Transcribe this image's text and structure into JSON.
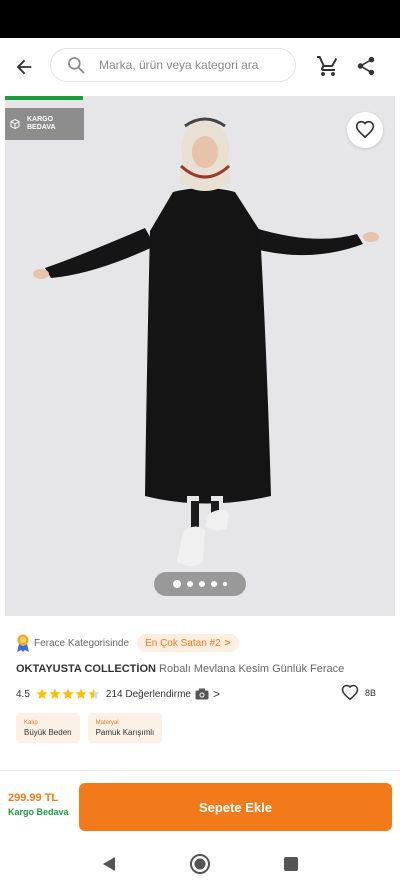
{
  "header": {
    "search_placeholder": "Marka, ürün veya kategori ara"
  },
  "icons": {
    "back": "arrow-left-icon",
    "search": "search-icon",
    "cart": "cart-icon",
    "share": "share-icon",
    "favorite": "heart-icon",
    "kargo": "box-icon",
    "medal": "medal-icon",
    "camera": "camera-icon"
  },
  "hero": {
    "badge_line1": "KARGO",
    "badge_line2": "BEDAVA",
    "image_count": 5,
    "active_index": 0
  },
  "category": {
    "text": "Ferace Kategorisinde",
    "rank_label": "En Çok Satan #2",
    "chevron": ">"
  },
  "product": {
    "brand": "OKTAYUSTA COLLECTİON",
    "name": "Robalı Mevlana Kesim Günlük Ferace"
  },
  "rating": {
    "value": "4.5",
    "stars": 4.5,
    "reviews": "214 Değerlendirme",
    "chevron": ">",
    "favorites": "8B"
  },
  "attributes": [
    {
      "key": "Kalıp",
      "value": "Büyük Beden"
    },
    {
      "key": "Materyal",
      "value": "Pamuk Karışımlı"
    }
  ],
  "footer": {
    "price": "299.99 TL",
    "shipping": "Kargo Bedava",
    "add_to_cart": "Sepete Ekle"
  },
  "colors": {
    "accent": "#f27a1a",
    "green": "#1b9a3e",
    "star": "#ffc000"
  }
}
